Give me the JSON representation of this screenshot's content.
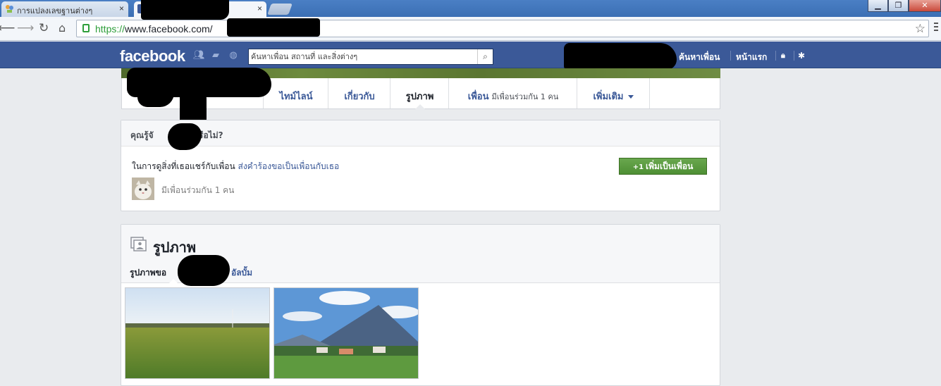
{
  "browser": {
    "tabs": [
      {
        "title": "การแปลงเลขฐานต่างๆ",
        "active": false
      },
      {
        "title": "",
        "active": true
      }
    ],
    "close_glyph": "×",
    "url_scheme": "https://",
    "url_host": "www.facebook.com/",
    "nav_icons": [
      "back-icon",
      "forward-icon",
      "reload-icon",
      "home-icon"
    ],
    "window_controls": [
      "minimize",
      "maximize",
      "close"
    ]
  },
  "fb_header": {
    "logo": "facebook",
    "search_placeholder": "ค้นหาเพื่อน สถานที่ และสิ่งต่างๆ",
    "nav": {
      "find_friends": "ค้นหาเพื่อน",
      "home": "หน้าแรก"
    },
    "colors": {
      "bar": "#3b5998",
      "add_friend": "#5b9a3f"
    }
  },
  "profile_nav": {
    "items": [
      {
        "label": "ไทม์ไลน์",
        "sub": ""
      },
      {
        "label": "เกี่ยวกับ",
        "sub": ""
      },
      {
        "label": "รูปภาพ",
        "sub": "",
        "selected": true
      },
      {
        "label": "เพื่อน",
        "sub": "มีเพื่อนร่วมกัน 1 คน"
      },
      {
        "label": "เพิ่มเติม",
        "sub": ""
      }
    ]
  },
  "know_box": {
    "question_prefix": "คุณรู้จั",
    "question_suffix": "รือไม่?",
    "share_text": "ในการดูสิ่งที่เธอแชร์กับเพื่อน",
    "send_request_link": "ส่งคำร้องขอเป็นเพื่อนกับเธอ",
    "add_friend_button": "เพิ่มเป็นเพื่อน",
    "add_friend_plus": "+1",
    "mutual_friends": "มีเพื่อนร่วมกัน 1 คน"
  },
  "photos": {
    "title": "รูปภาพ",
    "tab_photos_of": "รูปภาพขอ",
    "tab_albums": "อัลบั้ม"
  }
}
